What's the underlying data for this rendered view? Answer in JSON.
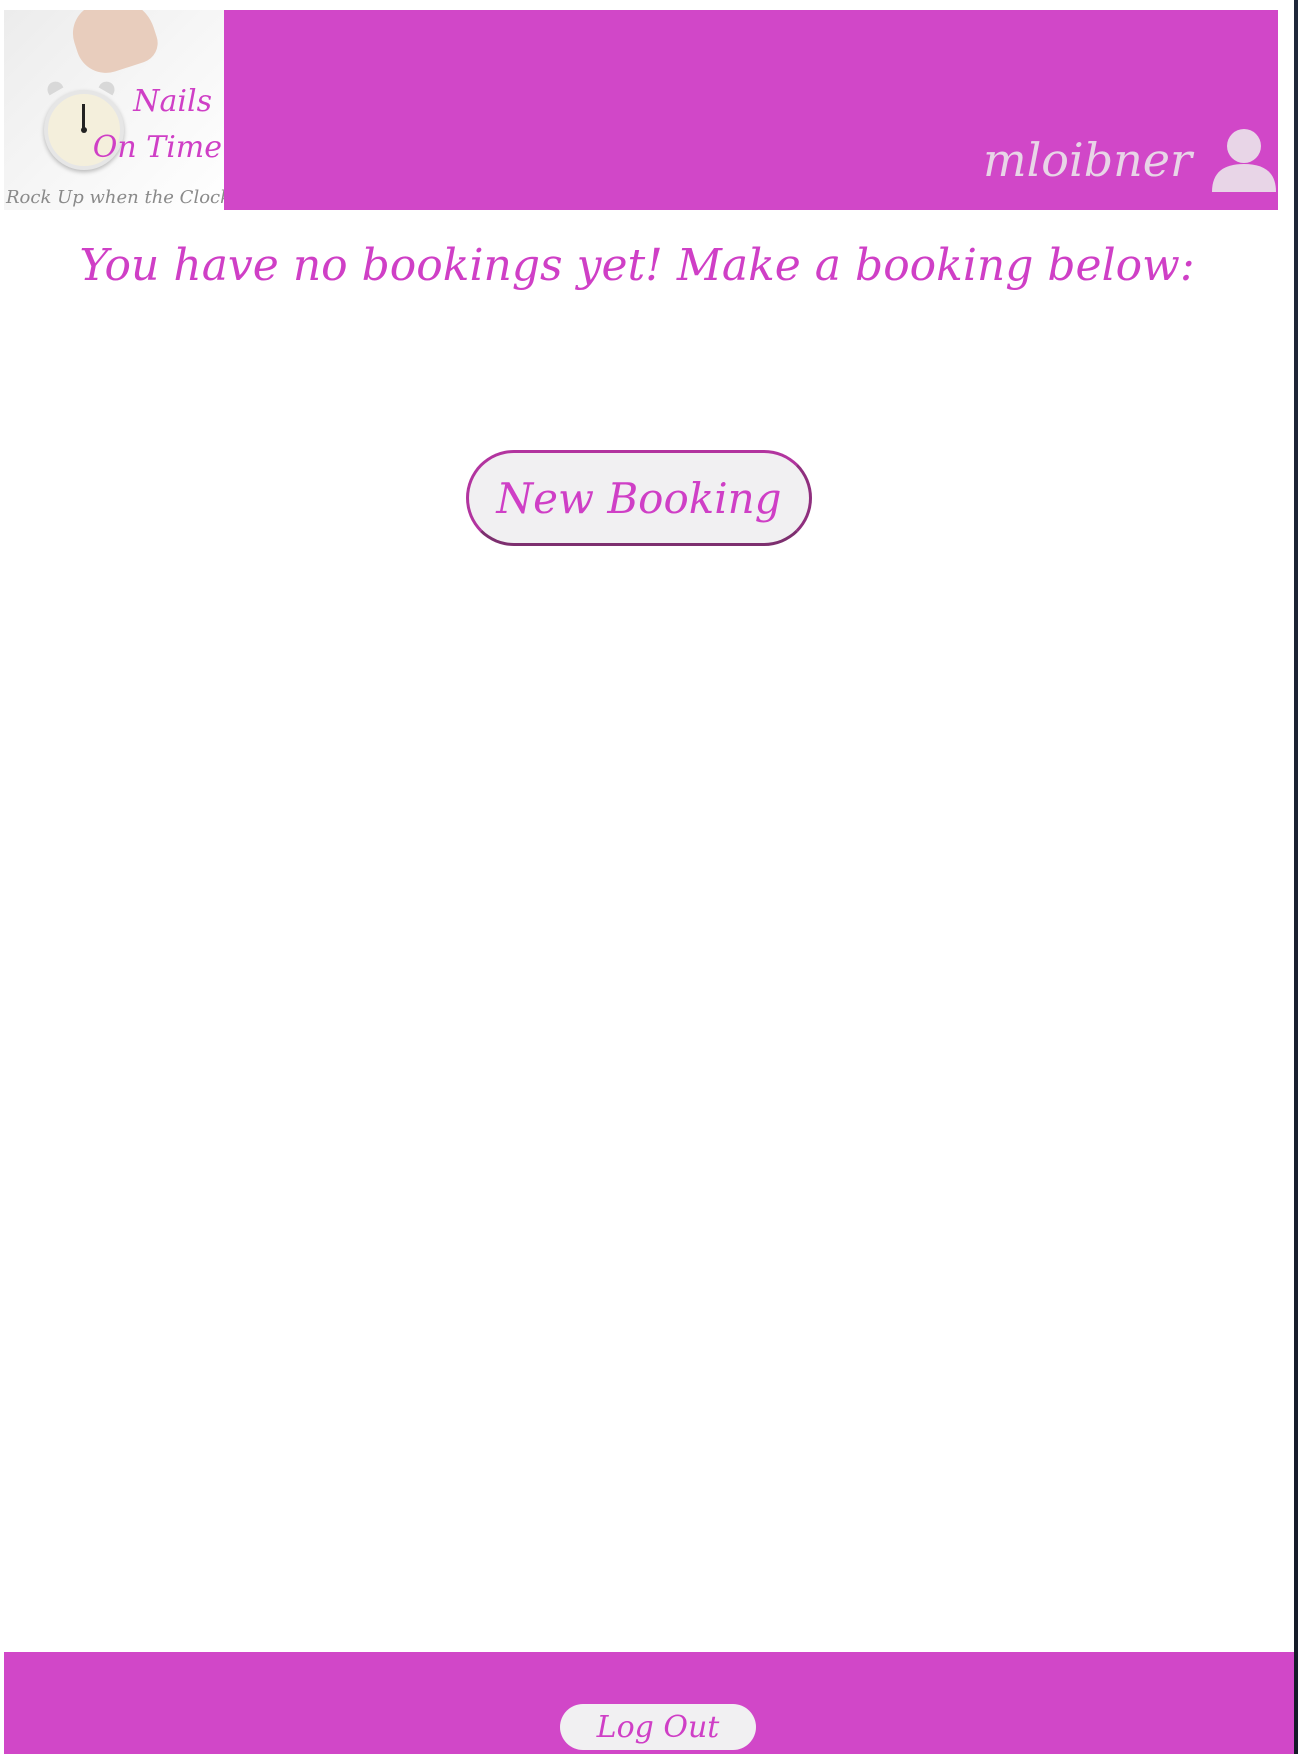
{
  "header": {
    "logo": {
      "brand_line1": "Nails",
      "brand_line2": "On Time",
      "tagline": "Rock Up when the Clock Up"
    },
    "username": "mloibner",
    "user_icon": "user-icon"
  },
  "main": {
    "heading": "You have no bookings yet! Make a booking below:",
    "new_booking_label": "New Booking"
  },
  "footer": {
    "logout_label": "Log Out"
  },
  "colors": {
    "brand": "#d147c8",
    "text_accent": "#cf3fc6",
    "button_bg": "#f1f0f2"
  }
}
